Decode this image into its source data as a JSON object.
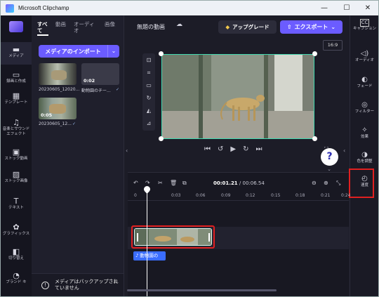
{
  "window": {
    "title": "Microsoft Clipchamp",
    "minimize": "—",
    "maximize": "☐",
    "close": "✕"
  },
  "left_rail": {
    "items": [
      {
        "label": "メディア",
        "icon": "media-icon",
        "glyph": "▬",
        "active": true
      },
      {
        "label": "録画と作成",
        "icon": "record-icon",
        "glyph": "▭"
      },
      {
        "label": "テンプレート",
        "icon": "template-icon",
        "glyph": "▦"
      },
      {
        "label": "音楽とサウンドエフェクト",
        "icon": "music-icon",
        "glyph": "♫"
      },
      {
        "label": "ストック動画",
        "icon": "stock-video-icon",
        "glyph": "▣"
      },
      {
        "label": "ストック画像",
        "icon": "stock-image-icon",
        "glyph": "▨"
      },
      {
        "label": "テキスト",
        "icon": "text-icon",
        "glyph": "T"
      },
      {
        "label": "グラフィックス",
        "icon": "graphics-icon",
        "glyph": "✿"
      },
      {
        "label": "切り替え",
        "icon": "transition-icon",
        "glyph": "◧"
      },
      {
        "label": "ブランド キ",
        "icon": "brand-kit-icon",
        "glyph": "◔"
      }
    ]
  },
  "media_panel": {
    "tabs": [
      {
        "label": "すべて",
        "active": true
      },
      {
        "label": "動画"
      },
      {
        "label": "オーディオ"
      },
      {
        "label": "画像"
      }
    ],
    "import_label": "メディアのインポート",
    "import_dropdown": "⌄",
    "items": [
      {
        "caption": "20230605_12020...",
        "duration": ""
      },
      {
        "caption": "動物園のチー...",
        "duration": "0:02",
        "check": "✓"
      },
      {
        "caption": "20230605_12...",
        "duration": "0:05",
        "check": "✓"
      }
    ],
    "backup_text": "メディアはバックアップされていません",
    "backup_icon": "!",
    "backup_chevron": "^"
  },
  "topbar": {
    "project_name": "無題の動画",
    "upgrade_label": "アップグレード",
    "upgrade_icon": "◆",
    "export_label": "エクスポート",
    "export_icon": "⇧",
    "export_chevron": "⌄",
    "aspect_ratio": "16:9"
  },
  "playback": {
    "skip_back": "⏮",
    "rewind": "↺",
    "play": "▶",
    "forward": "↻",
    "skip_forward": "⏭",
    "fullscreen": "⛶",
    "help": "?"
  },
  "right_rail": {
    "items": [
      {
        "label": "キャプション",
        "icon": "captions-icon",
        "glyph": "CC"
      },
      {
        "label": "オーディオ",
        "icon": "audio-icon",
        "glyph": "◁)"
      },
      {
        "label": "フェード",
        "icon": "fade-icon",
        "glyph": "◐"
      },
      {
        "label": "フィルター",
        "icon": "filter-icon",
        "glyph": "◎"
      },
      {
        "label": "効果",
        "icon": "effects-icon",
        "glyph": "✧"
      },
      {
        "label": "色を調整",
        "icon": "color-adjust-icon",
        "glyph": "◑"
      },
      {
        "label": "速度",
        "icon": "speed-icon",
        "glyph": "◴"
      }
    ]
  },
  "timeline": {
    "current_time": "00:01.21",
    "total_time": "/ 00:06.54",
    "ticks": [
      "0",
      "0:03",
      "0:06",
      "0:09",
      "0:12",
      "0:15",
      "0:18",
      "0:21",
      "0:24"
    ],
    "audio_clip_label": "動物園の",
    "audio_icon": "♪",
    "undo": "↶",
    "redo": "↷",
    "split": "✂",
    "delete": "🗑",
    "zoom_out": "⊖",
    "zoom_in": "⊕",
    "fit": "⤡"
  }
}
